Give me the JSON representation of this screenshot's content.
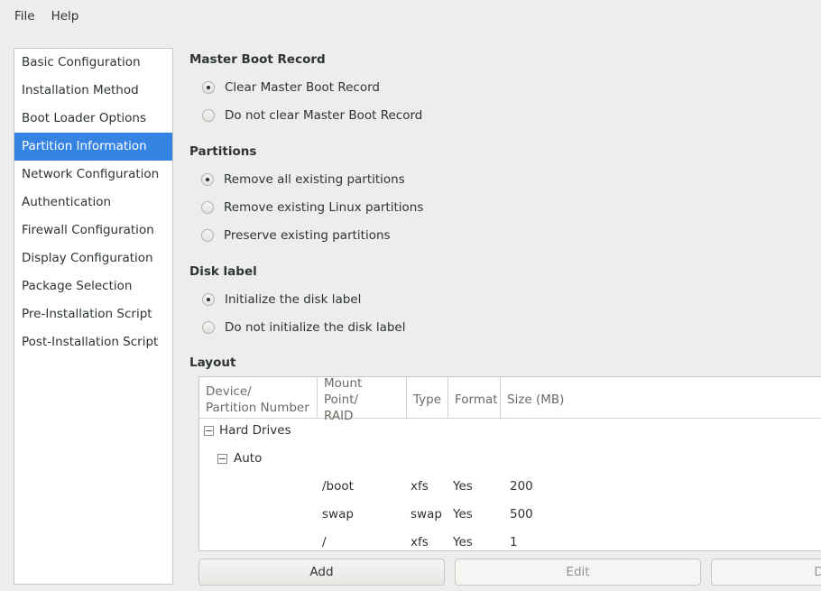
{
  "menubar": {
    "items": [
      {
        "label": "File",
        "name": "menu-file"
      },
      {
        "label": "Help",
        "name": "menu-help"
      }
    ]
  },
  "sidebar": {
    "items": [
      {
        "label": "Basic Configuration",
        "selected": false
      },
      {
        "label": "Installation Method",
        "selected": false
      },
      {
        "label": "Boot Loader Options",
        "selected": false
      },
      {
        "label": "Partition Information",
        "selected": true
      },
      {
        "label": "Network Configuration",
        "selected": false
      },
      {
        "label": "Authentication",
        "selected": false
      },
      {
        "label": "Firewall Configuration",
        "selected": false
      },
      {
        "label": "Display Configuration",
        "selected": false
      },
      {
        "label": "Package Selection",
        "selected": false
      },
      {
        "label": "Pre-Installation Script",
        "selected": false
      },
      {
        "label": "Post-Installation Script",
        "selected": false
      }
    ],
    "selected_color": "#3584e4"
  },
  "main": {
    "mbr": {
      "title": "Master Boot Record",
      "options": [
        {
          "label": "Clear Master Boot Record",
          "checked": true
        },
        {
          "label": "Do not clear Master Boot Record",
          "checked": false
        }
      ]
    },
    "partitions": {
      "title": "Partitions",
      "options": [
        {
          "label": "Remove all existing partitions",
          "checked": true
        },
        {
          "label": "Remove existing Linux partitions",
          "checked": false
        },
        {
          "label": "Preserve existing partitions",
          "checked": false
        }
      ]
    },
    "disklabel": {
      "title": "Disk label",
      "options": [
        {
          "label": "Initialize the disk label",
          "checked": true
        },
        {
          "label": "Do not initialize the disk label",
          "checked": false
        }
      ]
    },
    "layout": {
      "title": "Layout",
      "columns": [
        "Device/\nPartition Number",
        "Mount Point/\nRAID",
        "Type",
        "Format",
        "Size (MB)"
      ],
      "rows": [
        {
          "kind": "group",
          "depth": 0,
          "device": "Hard Drives",
          "mount": "",
          "type": "",
          "format": "",
          "size": "",
          "expander": "minus-icon"
        },
        {
          "kind": "group",
          "depth": 1,
          "device": "Auto",
          "mount": "",
          "type": "",
          "format": "",
          "size": "",
          "expander": "minus-icon"
        },
        {
          "kind": "item",
          "depth": 2,
          "device": "",
          "mount": "/boot",
          "type": "xfs",
          "format": "Yes",
          "size": "200"
        },
        {
          "kind": "item",
          "depth": 2,
          "device": "",
          "mount": "swap",
          "type": "swap",
          "format": "Yes",
          "size": "500"
        },
        {
          "kind": "item",
          "depth": 2,
          "device": "",
          "mount": "/",
          "type": "xfs",
          "format": "Yes",
          "size": "1"
        }
      ]
    },
    "buttons": [
      {
        "label": "Add",
        "enabled": true
      },
      {
        "label": "Edit",
        "enabled": false
      },
      {
        "label": "Delete",
        "enabled": false
      }
    ]
  }
}
